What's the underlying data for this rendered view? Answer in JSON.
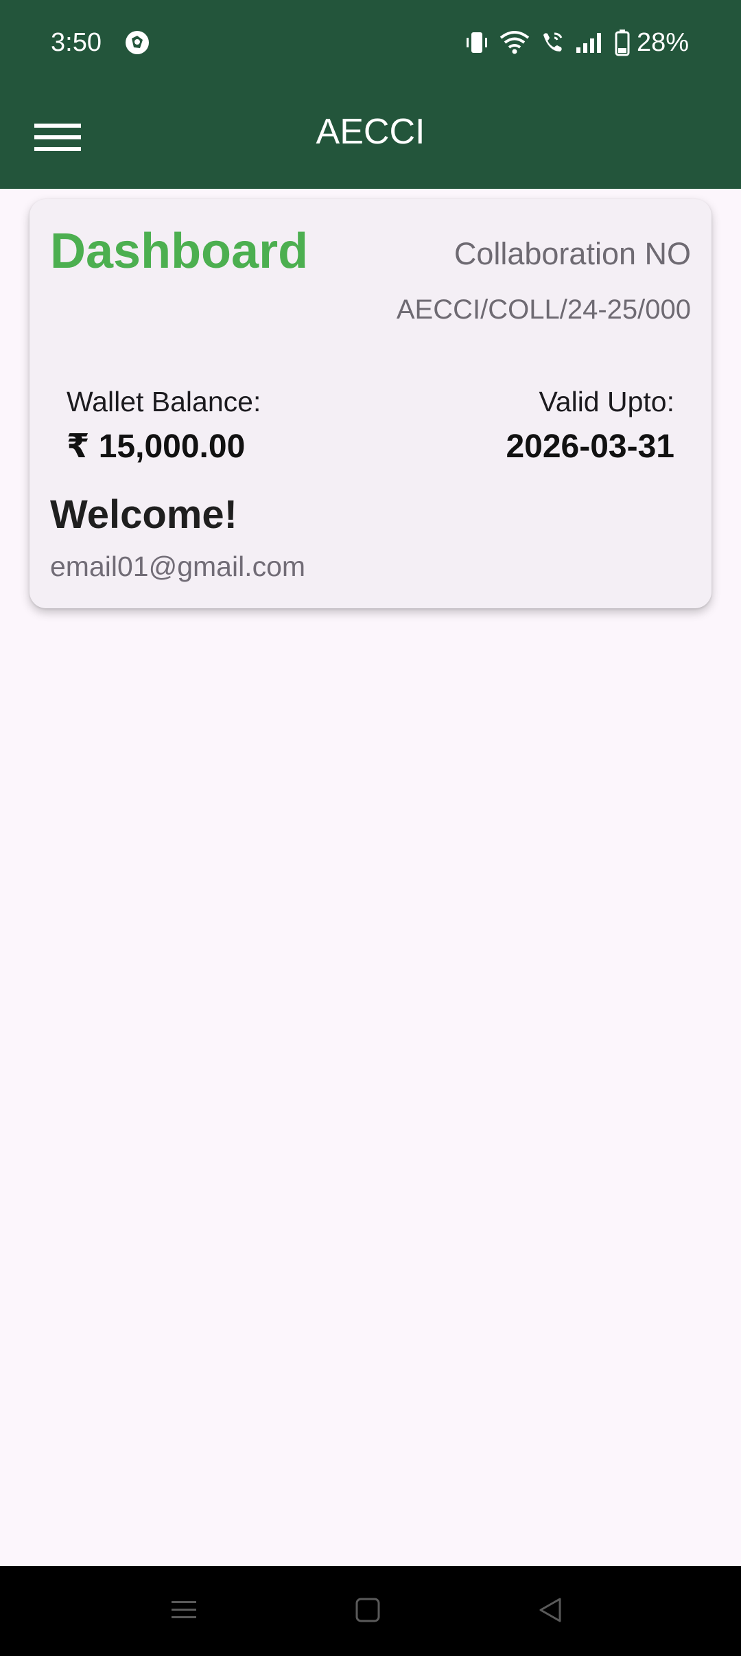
{
  "status_bar": {
    "time": "3:50",
    "icons": [
      "app-notification-icon",
      "vibrate-icon",
      "wifi-icon",
      "wifi-call-icon",
      "signal-icon",
      "battery-icon"
    ],
    "battery_percent": "28%"
  },
  "app_bar": {
    "title": "AECCI",
    "menu_icon": "menu-icon"
  },
  "dashboard": {
    "title": "Dashboard",
    "collaboration_label": "Collaboration NO",
    "collaboration_number": "AECCI/COLL/24-25/000",
    "wallet_label": "Wallet Balance:",
    "wallet_value": "₹ 15,000.00",
    "valid_label": "Valid Upto:",
    "valid_value": "2026-03-31",
    "welcome": "Welcome!",
    "email": "email01@gmail.com"
  },
  "nav_bar": {
    "buttons": [
      "recent-apps-icon",
      "home-icon",
      "back-icon"
    ]
  },
  "colors": {
    "primary": "#23553b",
    "accent": "#4caf50",
    "background": "#fcf6fc",
    "card": "#f4eff5"
  }
}
